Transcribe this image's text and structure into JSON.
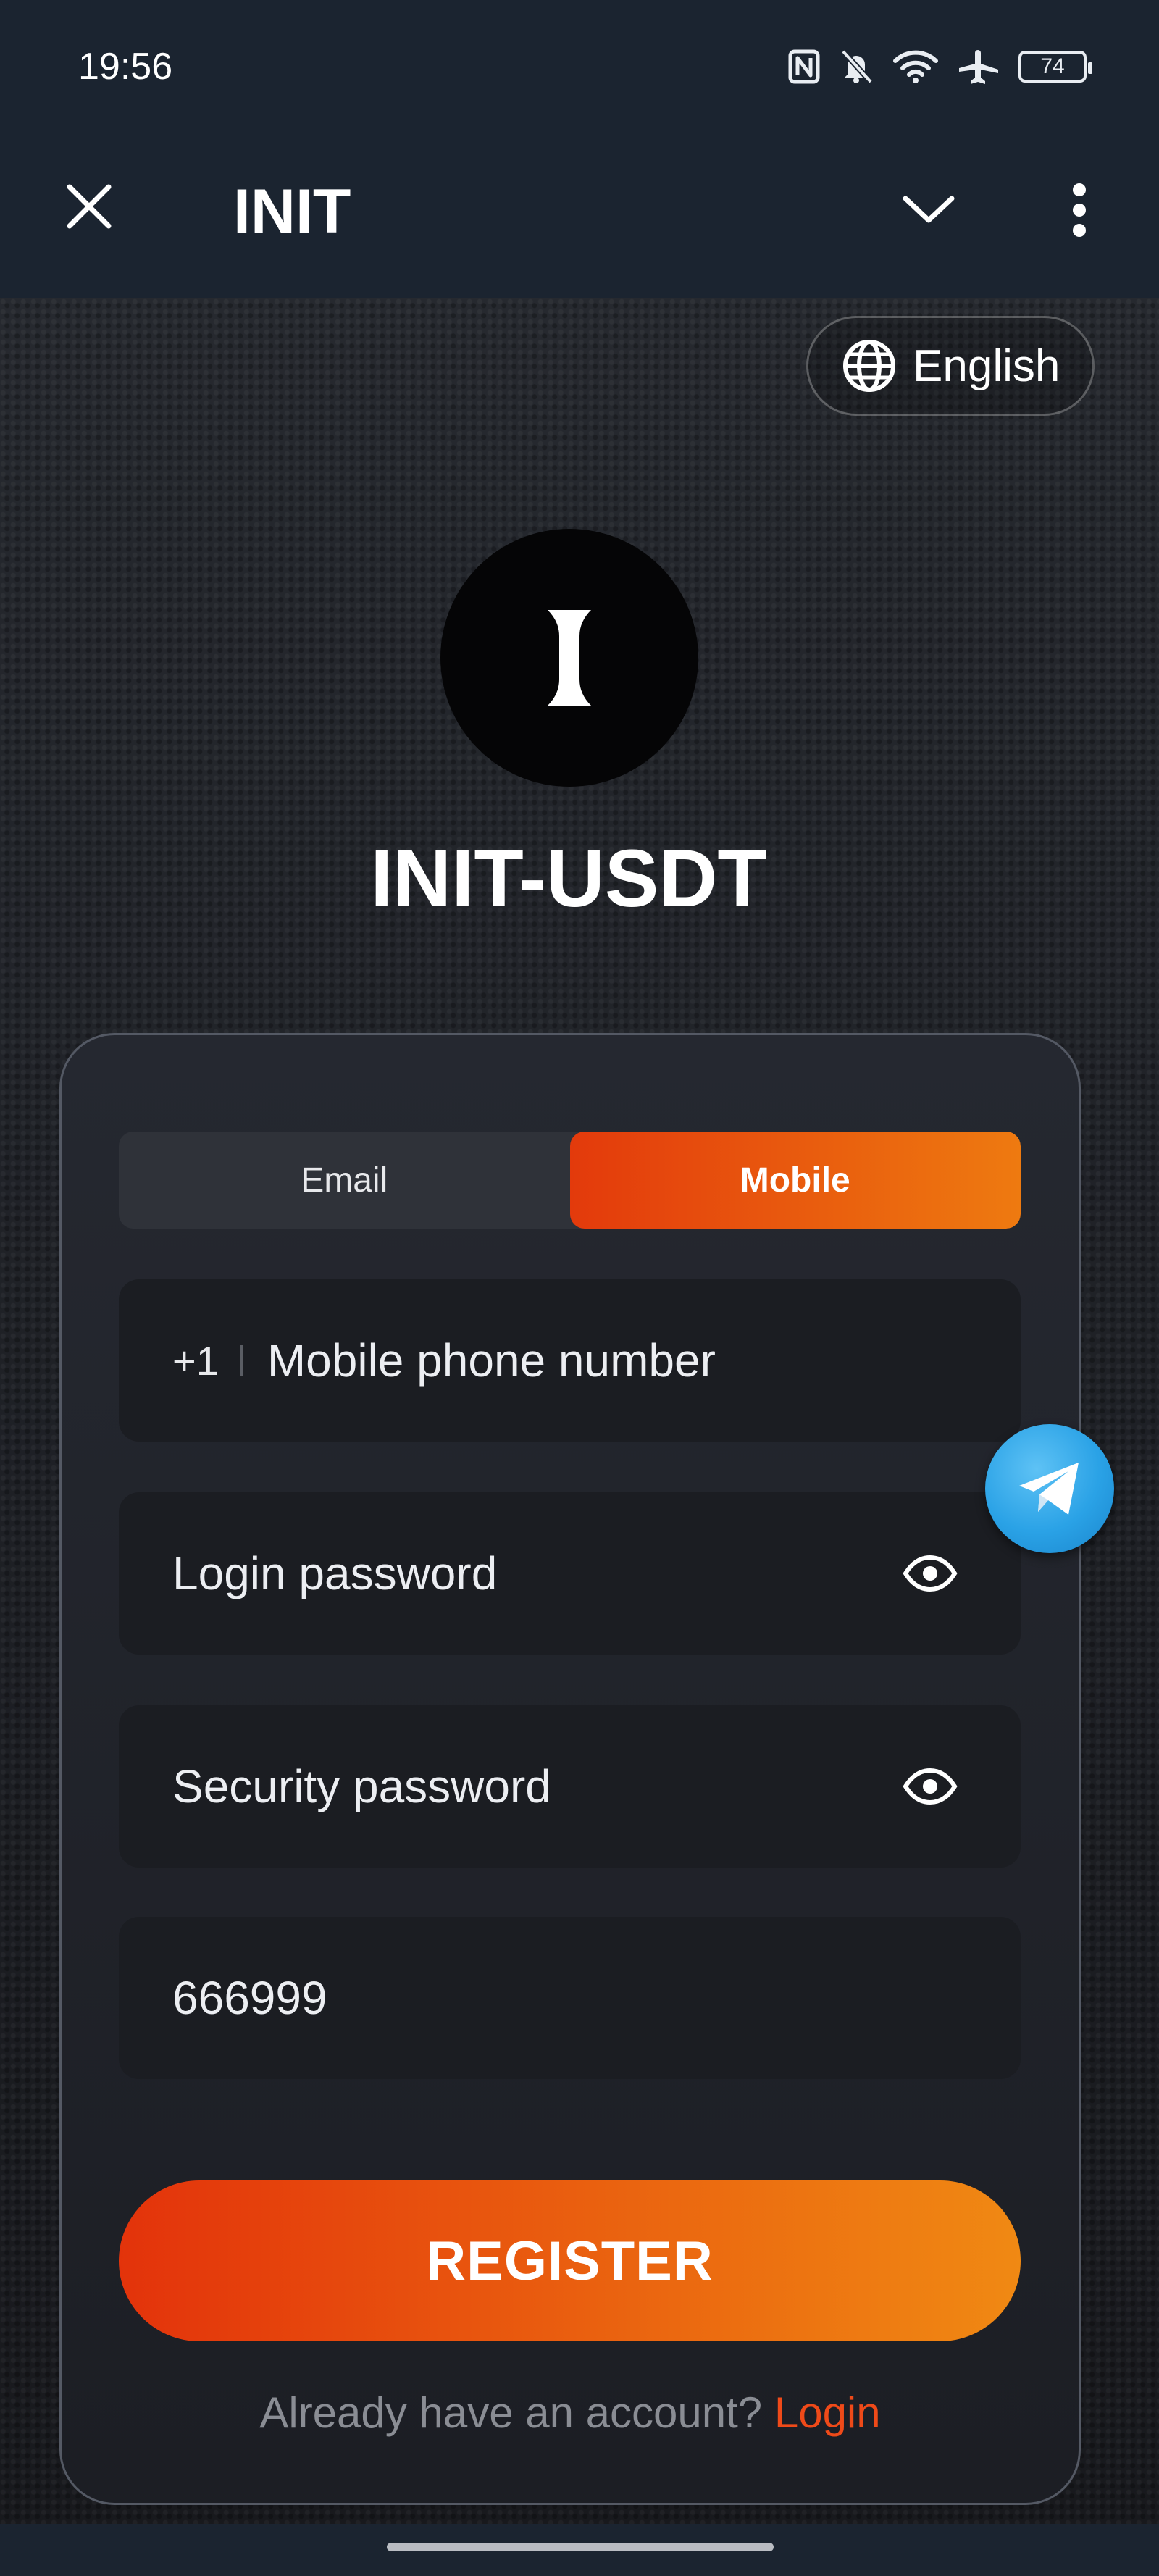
{
  "status_bar": {
    "time": "19:56",
    "battery": "74",
    "icons": [
      "nfc-icon",
      "bell-off-icon",
      "wifi-icon",
      "airplane-icon",
      "battery-icon"
    ]
  },
  "app_bar": {
    "title": "INIT",
    "icons": [
      "close-icon",
      "chevron-down-icon",
      "more-vertical-icon"
    ]
  },
  "language": {
    "label": "English",
    "icon": "globe-icon"
  },
  "brand": {
    "title": "INIT-USDT",
    "logo_icon": "init-logo-icon"
  },
  "tabs": [
    {
      "label": "Email",
      "active": false
    },
    {
      "label": "Mobile",
      "active": true
    }
  ],
  "form": {
    "country_code": "+1",
    "phone_placeholder": "Mobile phone number",
    "login_password_placeholder": "Login password",
    "security_password_placeholder": "Security password",
    "invite_code_value": "666999"
  },
  "register_label": "REGISTER",
  "login_prompt": {
    "text": "Already have an account?",
    "link": "Login"
  },
  "floating": {
    "icon": "telegram-icon"
  },
  "colors": {
    "accent_start": "#e3330b",
    "accent_end": "#f08913",
    "link": "#ef4a19",
    "bar_bg": "#1b2430"
  }
}
